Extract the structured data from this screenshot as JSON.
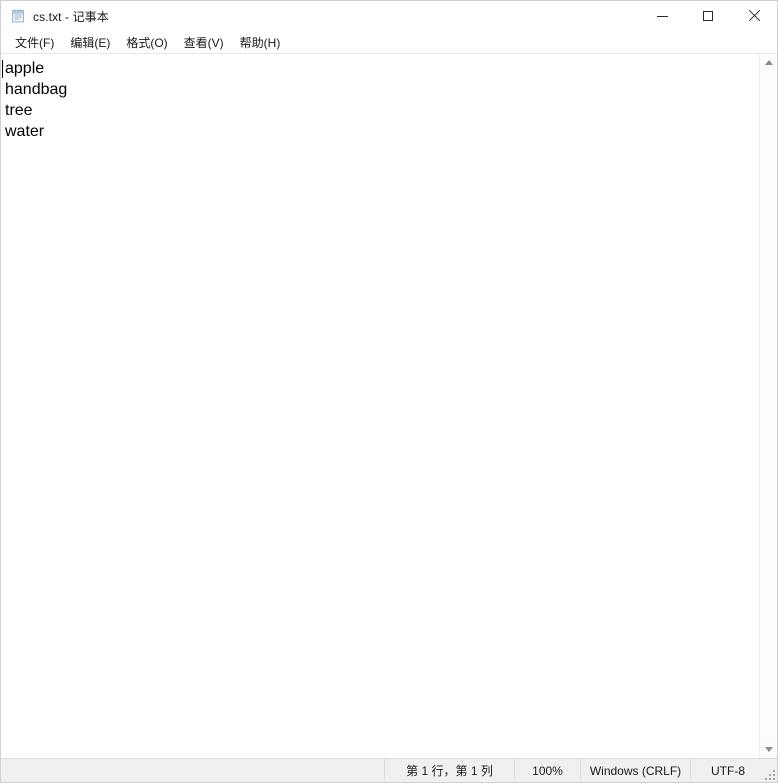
{
  "window": {
    "title": "cs.txt - 记事本",
    "icon": "notepad-icon"
  },
  "titlebar": {
    "minimize_label": "—",
    "maximize_label": "□",
    "close_label": "✕"
  },
  "menubar": {
    "items": [
      {
        "label": "文件(F)",
        "name": "file"
      },
      {
        "label": "编辑(E)",
        "name": "edit"
      },
      {
        "label": "格式(O)",
        "name": "format"
      },
      {
        "label": "查看(V)",
        "name": "view"
      },
      {
        "label": "帮助(H)",
        "name": "help"
      }
    ]
  },
  "editor": {
    "lines": [
      "apple",
      "handbag",
      "tree",
      "water"
    ]
  },
  "scrollbar": {
    "up_arrow": "chevron-up-icon",
    "down_arrow": "chevron-down-icon"
  },
  "statusbar": {
    "cursor_position": "第 1 行，第 1 列",
    "zoom": "100%",
    "line_ending": "Windows (CRLF)",
    "encoding": "UTF-8"
  },
  "colors": {
    "window_bg": "#ffffff",
    "statusbar_bg": "#f0f0f0",
    "text": "#000000",
    "border": "#dcdcdc"
  }
}
